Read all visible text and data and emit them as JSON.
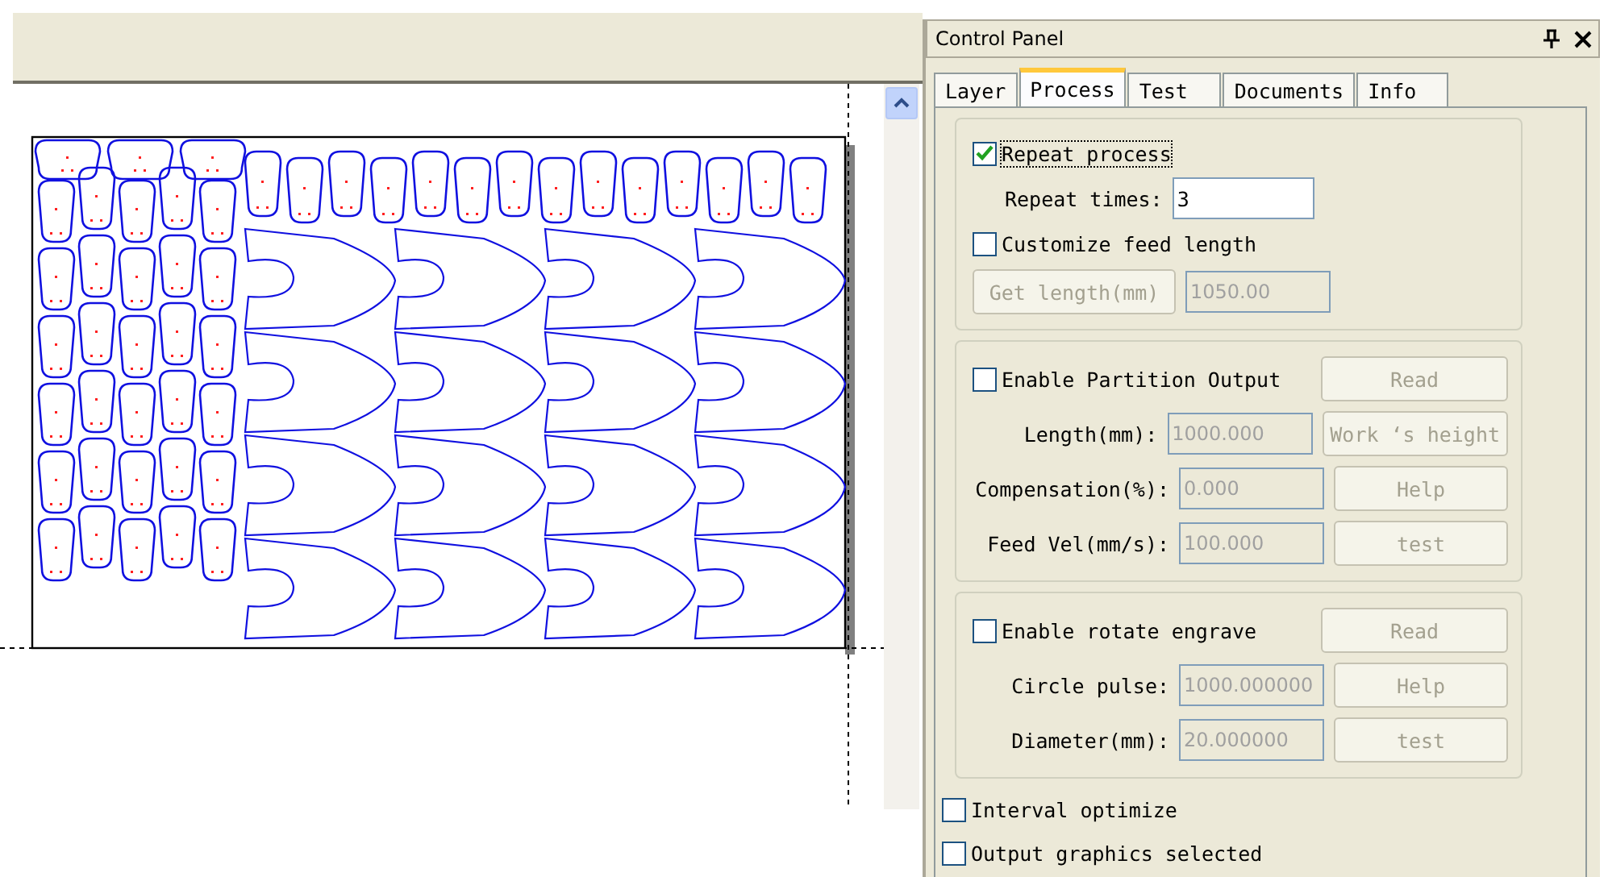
{
  "panel": {
    "title": "Control Panel"
  },
  "tabs": [
    {
      "label": "Layer",
      "selected": false
    },
    {
      "label": "Process",
      "selected": true
    },
    {
      "label": "Test",
      "selected": false
    },
    {
      "label": "Documents",
      "selected": false
    },
    {
      "label": "Info",
      "selected": false
    }
  ],
  "repeat": {
    "label": "Repeat process",
    "checked": true,
    "times_label": "Repeat times:",
    "times_value": "3"
  },
  "feed": {
    "label": "Customize feed length",
    "checked": false,
    "disabled": true,
    "button": "Get length(mm)",
    "value": "1050.00"
  },
  "sections": [
    {
      "label": "Enable Partition Output",
      "checked": false,
      "disabled": true,
      "button": "Read",
      "fields": [
        {
          "label": "Length(mm):",
          "value": "1000.000",
          "button": "Work ‘s height"
        },
        {
          "label": "Compensation(%):",
          "value": "0.000",
          "button": "Help"
        },
        {
          "label": "Feed Vel(mm/s):",
          "value": "100.000",
          "button": "test"
        }
      ]
    },
    {
      "label": "Enable rotate engrave",
      "checked": false,
      "disabled": true,
      "button": "Read",
      "fields": [
        {
          "label": "Circle pulse:",
          "value": "1000.000000",
          "button": "Help"
        },
        {
          "label": "Diameter(mm):",
          "value": "20.000000",
          "button": "test"
        }
      ]
    }
  ],
  "options": [
    {
      "label": "Interval optimize",
      "checked": false
    },
    {
      "label": "Output graphics selected",
      "checked": false
    }
  ]
}
